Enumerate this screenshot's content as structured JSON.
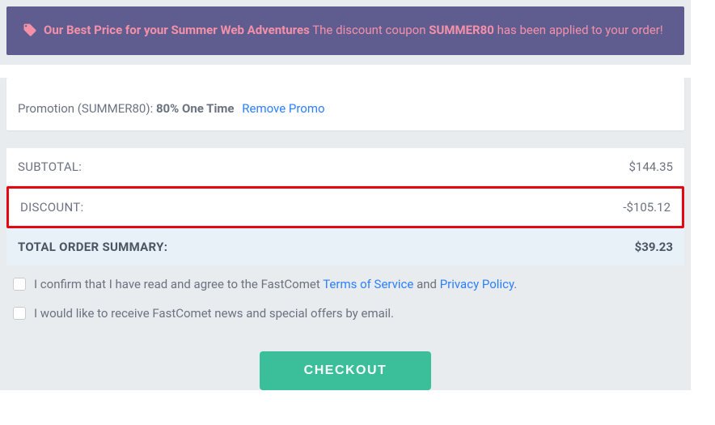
{
  "banner": {
    "bold": "Our Best Price for your Summer Web Adventures",
    "mid1": " The discount coupon ",
    "code": "SUMMER80",
    "mid2": " has been applied to your order!"
  },
  "promo": {
    "prefix": "Promotion (SUMMER80): ",
    "amount": "80% One Time",
    "remove": "Remove Promo"
  },
  "summary": {
    "subtotal_label": "SUBTOTAL:",
    "subtotal_value": "$144.35",
    "discount_label": "DISCOUNT:",
    "discount_value": "-$105.12",
    "total_label": "TOTAL ORDER SUMMARY:",
    "total_value": "$39.23"
  },
  "agree": {
    "pre": "I confirm that I have read and agree to the FastComet ",
    "tos": "Terms of Service",
    "and": " and ",
    "pp": "Privacy Policy",
    "dot": "."
  },
  "newsletter": "I would like to receive FastComet news and special offers by email.",
  "checkout": "CHECKOUT"
}
